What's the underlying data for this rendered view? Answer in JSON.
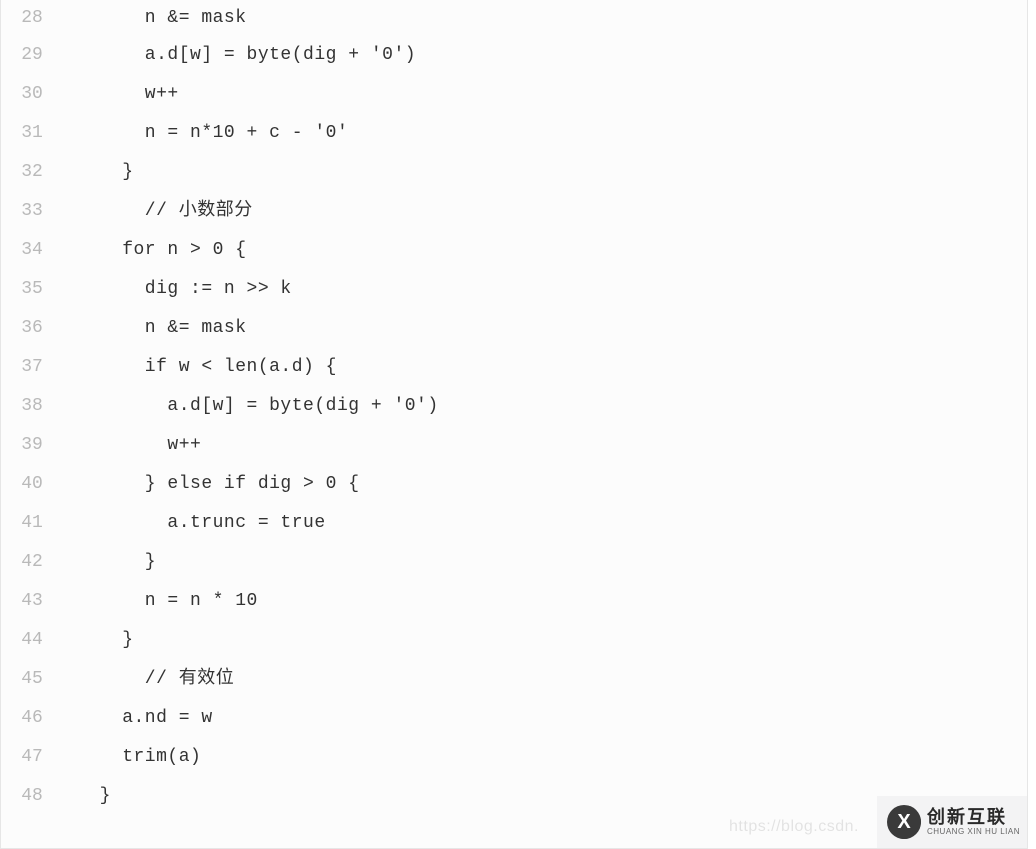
{
  "watermark_url": "https://blog.csdn.",
  "brand": {
    "glyph": "X",
    "cn": "创新互联",
    "pinyin": "CHUANG XIN HU LIAN"
  },
  "lines": [
    {
      "n": "28",
      "indent": "      ",
      "text": "n &= mask"
    },
    {
      "n": "29",
      "indent": "      ",
      "text": "a.d[w] = byte(dig + '0')"
    },
    {
      "n": "30",
      "indent": "      ",
      "text": "w++"
    },
    {
      "n": "31",
      "indent": "      ",
      "text": "n = n*10 + c - '0'"
    },
    {
      "n": "32",
      "indent": "    ",
      "text": "}"
    },
    {
      "n": "33",
      "indent": "      ",
      "text": "// 小数部分",
      "comment": true
    },
    {
      "n": "34",
      "indent": "    ",
      "text": "for n > 0 {"
    },
    {
      "n": "35",
      "indent": "      ",
      "text": "dig := n >> k"
    },
    {
      "n": "36",
      "indent": "      ",
      "text": "n &= mask"
    },
    {
      "n": "37",
      "indent": "      ",
      "text": "if w < len(a.d) {"
    },
    {
      "n": "38",
      "indent": "        ",
      "text": "a.d[w] = byte(dig + '0')"
    },
    {
      "n": "39",
      "indent": "        ",
      "text": "w++"
    },
    {
      "n": "40",
      "indent": "      ",
      "text": "} else if dig > 0 {"
    },
    {
      "n": "41",
      "indent": "        ",
      "text": "a.trunc = true"
    },
    {
      "n": "42",
      "indent": "      ",
      "text": "}"
    },
    {
      "n": "43",
      "indent": "      ",
      "text": "n = n * 10"
    },
    {
      "n": "44",
      "indent": "    ",
      "text": "}"
    },
    {
      "n": "45",
      "indent": "      ",
      "text": "// 有效位",
      "comment": true
    },
    {
      "n": "46",
      "indent": "    ",
      "text": "a.nd = w"
    },
    {
      "n": "47",
      "indent": "    ",
      "text": "trim(a)"
    },
    {
      "n": "48",
      "indent": "  ",
      "text": "}"
    }
  ]
}
